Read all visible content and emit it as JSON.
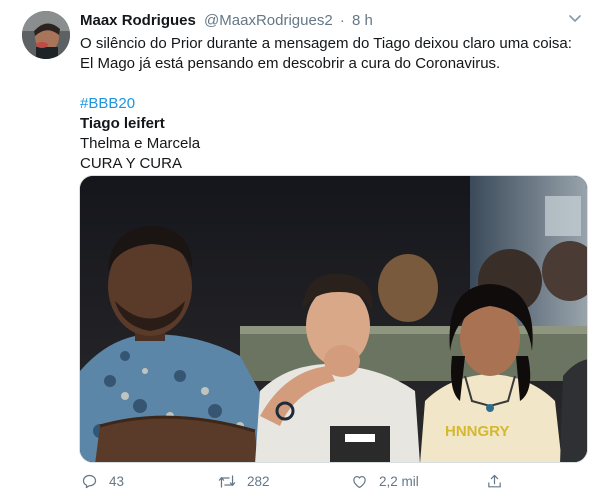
{
  "user": {
    "display_name": "Maax Rodrigues",
    "handle": "@MaaxRodrigues2",
    "separator": "·",
    "time": "8 h"
  },
  "tweet": {
    "text": "O silêncio do Prior durante a mensagem do Tiago deixou claro uma coisa: El Mago já está pensando em descobrir a cura do Coronavirus.",
    "hashtag": "#BBB20",
    "line_bold": "Tiago leifert",
    "line_2": "Thelma e Marcela",
    "line_3": "CURA Y CURA"
  },
  "media": {
    "shirt_text": "HNNGRY"
  },
  "actions": {
    "replies": "43",
    "retweets": "282",
    "likes": "2,2 mil"
  },
  "icons": {
    "reply": "reply-icon",
    "retweet": "retweet-icon",
    "like": "like-icon",
    "share": "share-icon",
    "caret": "chevron-down-icon"
  },
  "colors": {
    "link": "#1b95e0",
    "secondary": "#657786",
    "primary_text": "#14171a"
  }
}
